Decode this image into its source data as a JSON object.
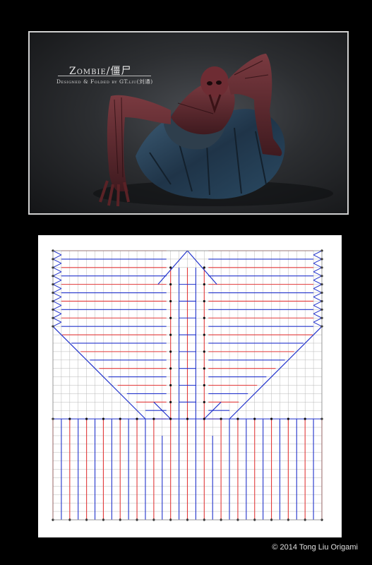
{
  "photo": {
    "title": "Zombie/僵尸",
    "subtitle": "Designed & Folded by GT.liu(刘通)"
  },
  "crease_pattern": {
    "mountain_color": "#e23a3a",
    "valley_color": "#2233cc",
    "grid_color": "#b8b8b8"
  },
  "footer": {
    "copyright": "© 2014 Tong Liu Origami"
  }
}
